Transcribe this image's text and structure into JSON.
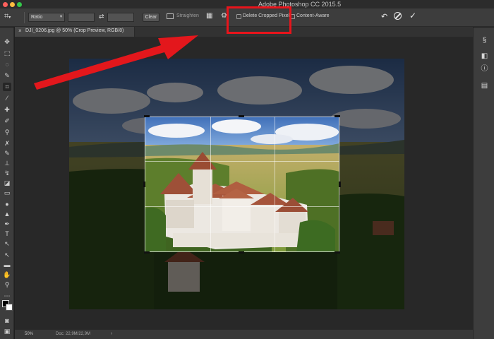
{
  "app_title": "Adobe Photoshop CC 2015.5",
  "options_bar": {
    "ratio_label": "Ratio",
    "clear_label": "Clear",
    "straighten_label": "Straighten",
    "delete_cropped_label": "Delete Cropped Pixels",
    "content_aware_label": "Content-Aware"
  },
  "document": {
    "tab_title": "DJI_0206.jpg @ 50% (Crop Preview, RGB/8)"
  },
  "status": {
    "zoom": "50%",
    "doc_size": "Doc: 22,9M/22,9M"
  },
  "colors": {
    "highlight": "#e8141b",
    "arrow": "#e3171c"
  },
  "icons": {
    "crop_tool": "crop-icon",
    "swap": "swap-arrows-icon",
    "grid_overlay": "grid-icon",
    "settings": "gear-icon",
    "reset": "undo-icon",
    "cancel": "cancel-icon",
    "commit": "checkmark-icon"
  }
}
